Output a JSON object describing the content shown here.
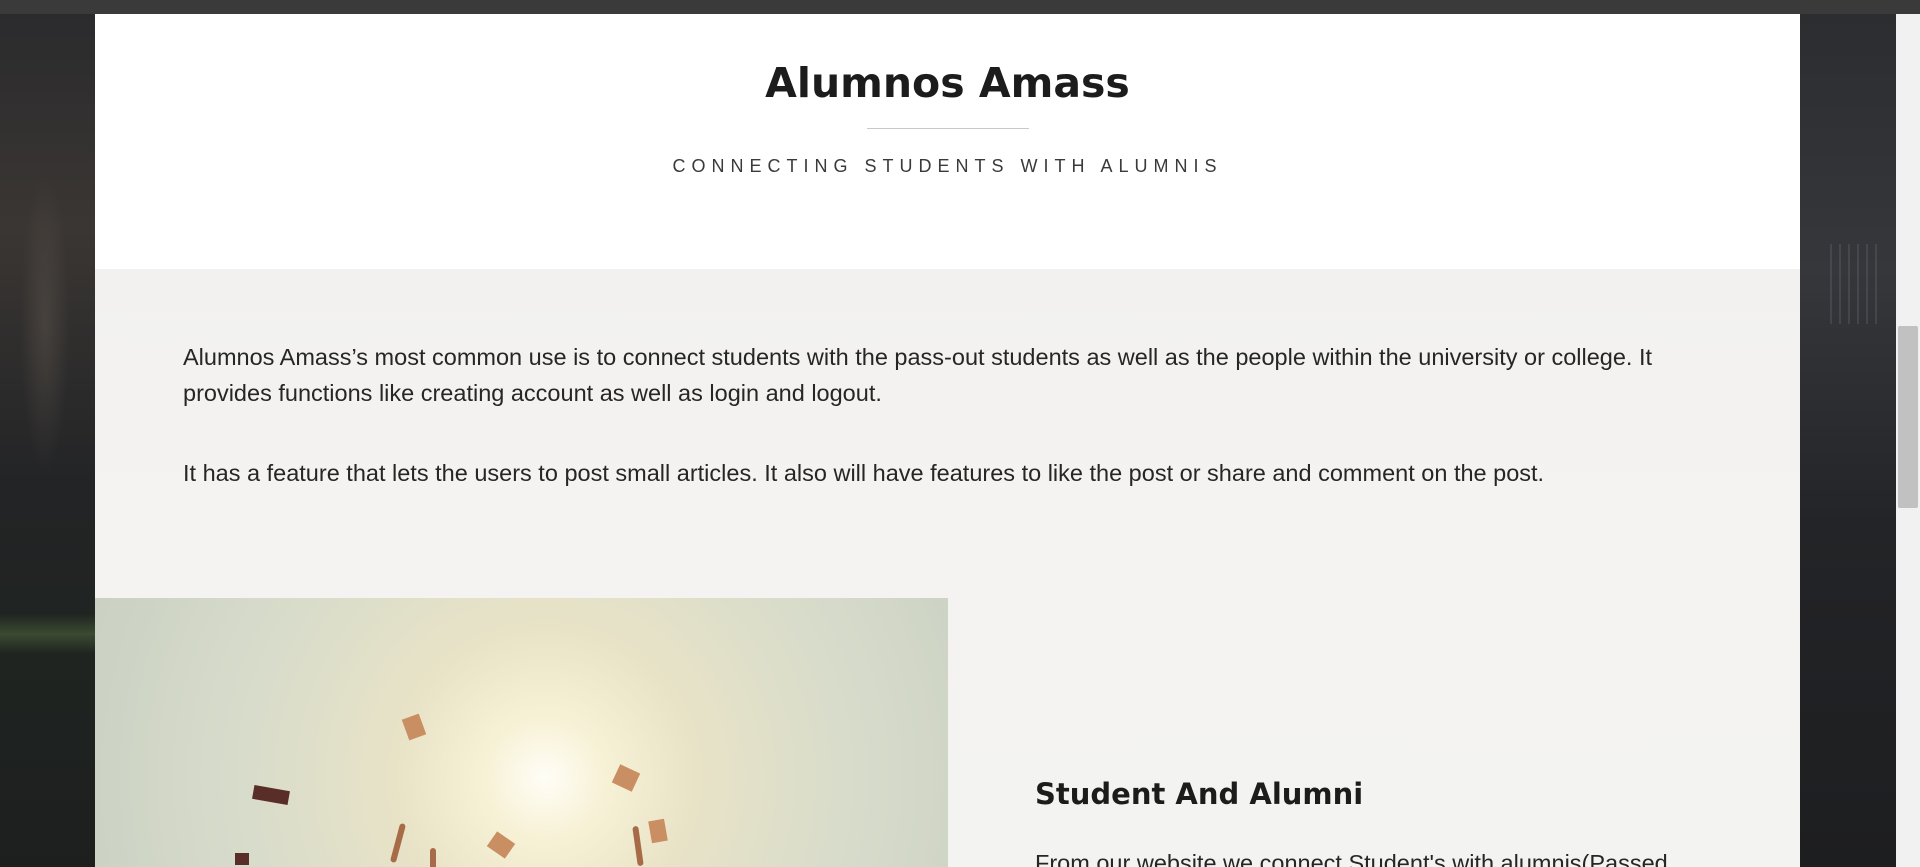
{
  "site": {
    "title": "Alumnos Amass",
    "tagline": "CONNECTING STUDENTS WITH ALUMNIS"
  },
  "about": {
    "paragraph1": "Alumnos Amass’s most common use is to connect students with the pass-out students as well as the people within the university or college. It provides functions like creating account as well as login and logout.",
    "paragraph2": "It has a feature that lets the users to post small articles. It also will have features to like the post or share and comment on the post."
  },
  "feature": {
    "title": "Student And Alumni",
    "text": "From our website we connect Student's with alumnis(Passed"
  },
  "colors": {
    "page_bg": "#232427",
    "header_bg": "#ffffff",
    "content_bg": "#f2f2f1",
    "text": "#262626",
    "title": "#1c1c1c"
  }
}
